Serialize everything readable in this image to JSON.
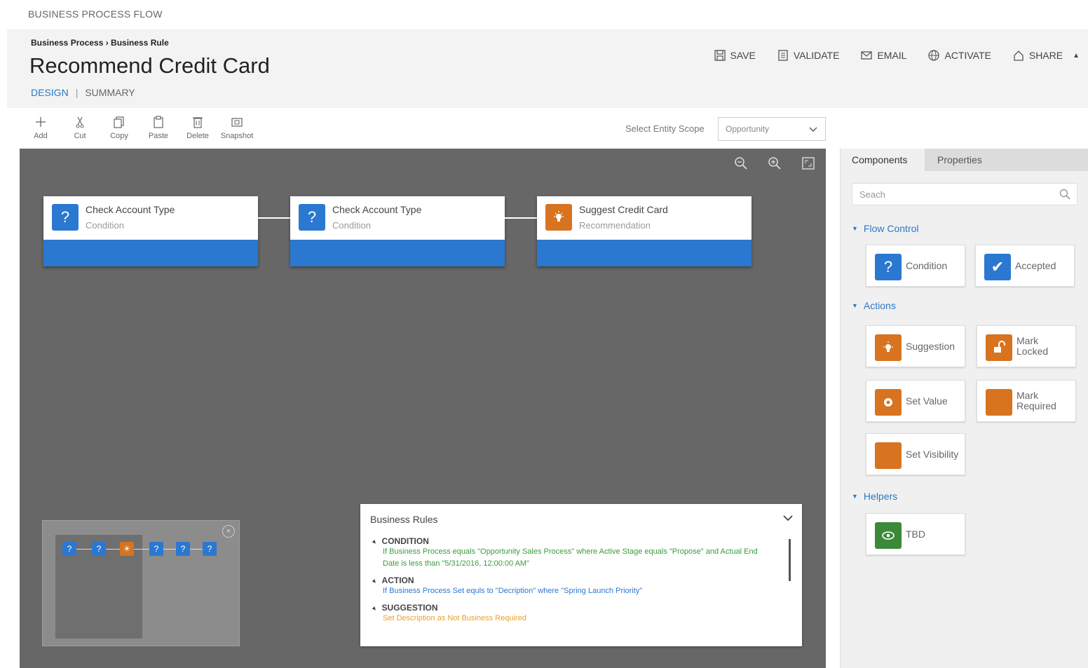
{
  "app": {
    "top_label": "BUSINESS PROCESS FLOW",
    "breadcrumb": "Business Process › Business Rule",
    "title": "Recommend Credit Card",
    "view_tabs": {
      "design": "DESIGN",
      "separator": "|",
      "summary": "SUMMARY"
    }
  },
  "commands": {
    "save": "SAVE",
    "validate": "VALIDATE",
    "email": "EMAIL",
    "activate": "ACTIVATE",
    "share": "SHARE"
  },
  "toolbar": {
    "add": "Add",
    "cut": "Cut",
    "copy": "Copy",
    "paste": "Paste",
    "delete": "Delete",
    "snapshot": "Snapshot"
  },
  "scope": {
    "label": "Select Entity Scope",
    "value": "Opportunity"
  },
  "flow": {
    "nodes": [
      {
        "icon": "?",
        "title": "Check Account Type",
        "subtitle": "Condition"
      },
      {
        "icon": "?",
        "title": "Check Account Type",
        "subtitle": "Condition"
      },
      {
        "icon": "bulb",
        "title": "Suggest Credit Card",
        "subtitle": "Recommendation"
      }
    ]
  },
  "minimap": {
    "nodes": [
      "?",
      "?",
      "bulb",
      "?",
      "?",
      "?"
    ],
    "close": "×"
  },
  "rules": {
    "title": "Business Rules",
    "condition_label": "CONDITION",
    "condition_text": "If Business Process equals \"Opportunity Sales Process\" where Active Stage equals \"Propose\" and Actual End Date is less than \"5/31/2016, 12:00:00 AM\"",
    "action_label": "ACTION",
    "action_text": "If Business Process Set equls to \"Decription\" where \"Spring Launch Priority\"",
    "suggestion_label": "SUGGESTION",
    "suggestion_text": "Set Description as Not Business Required"
  },
  "panel": {
    "tabs": {
      "components": "Components",
      "properties": "Properties"
    },
    "search_placeholder": "Seach",
    "sections": {
      "flow_control": "Flow Control",
      "actions": "Actions",
      "helpers": "Helpers"
    },
    "components": {
      "condition": "Condition",
      "accepted": "Accepted",
      "suggestion": "Suggestion",
      "mark_locked": "Mark Locked",
      "set_value": "Set Value",
      "mark_required": "Mark Required",
      "set_visibility": "Set Visibility",
      "tbd": "TBD"
    }
  },
  "colors": {
    "accent_blue": "#2b78d0",
    "action_orange": "#d8731f",
    "helper_green": "#3a8a3a",
    "canvas_gray": "#676767"
  }
}
